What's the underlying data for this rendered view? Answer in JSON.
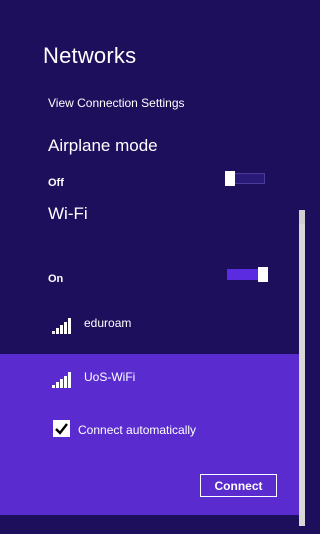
{
  "header": {
    "title": "Networks"
  },
  "links": {
    "view_settings": "View Connection Settings"
  },
  "airplane": {
    "label": "Airplane mode",
    "state": "Off",
    "on": false
  },
  "wifi": {
    "label": "Wi-Fi",
    "state": "On",
    "on": true
  },
  "networks": [
    {
      "name": "eduroam",
      "icon": "wifi-signal-icon",
      "selected": false
    },
    {
      "name": "UoS-WiFi",
      "icon": "wifi-signal-icon",
      "selected": true
    }
  ],
  "selected_network": {
    "connect_auto_label": "Connect automatically",
    "connect_auto_checked": true,
    "connect_button": "Connect"
  },
  "colors": {
    "background": "#1e0f5c",
    "selected": "#5a2cd0",
    "accent": "#5a2be0"
  }
}
